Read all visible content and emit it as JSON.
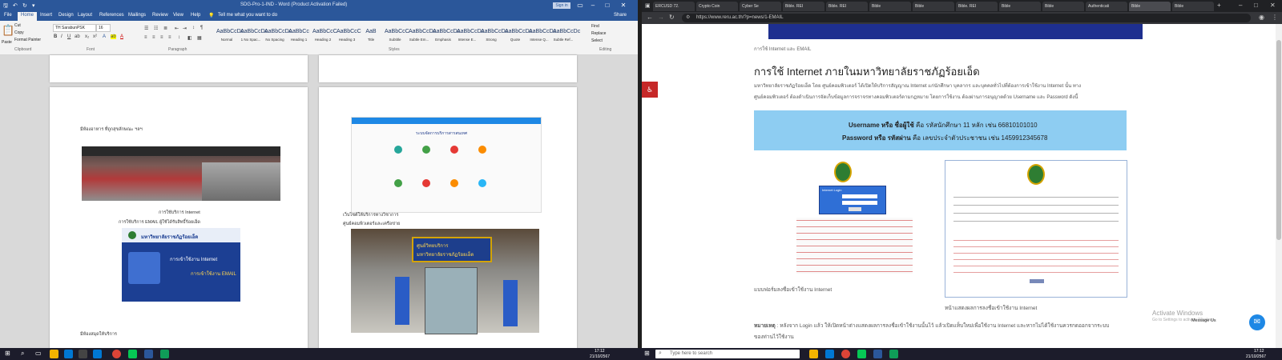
{
  "word": {
    "title_bar": {
      "doc_title": "SDG-Pro-1-IND - Word (Product Activation Failed)",
      "signin": "Sign in",
      "share": "Share"
    },
    "tabs": [
      "File",
      "Home",
      "Insert",
      "Design",
      "Layout",
      "References",
      "Mailings",
      "Review",
      "View",
      "Help"
    ],
    "tell_me": "Tell me what you want to do",
    "clipboard": {
      "paste": "Paste",
      "cut": "Cut",
      "copy": "Copy",
      "format_painter": "Format Painter",
      "label": "Clipboard"
    },
    "font": {
      "name": "TH SarabunPSK",
      "size": "16",
      "label": "Font"
    },
    "paragraph_label": "Paragraph",
    "styles": [
      "Normal",
      "1 No Spac...",
      "No Spacing",
      "Heading 1",
      "Heading 2",
      "Heading 3",
      "Title",
      "Subtitle",
      "Subtle Em...",
      "Emphasis",
      "Intense E...",
      "Strong",
      "Quote",
      "Intense Q...",
      "Subtle Ref..."
    ],
    "style_samples": [
      "AaBbCcDc",
      "AaBbCcDc",
      "AaBbCcDc",
      "AaBbCc",
      "AaBbCcC",
      "AaBbCcC",
      "AaB",
      "AaBbCcC",
      "AaBbCcDc",
      "AaBbCcDc",
      "AaBbCcDc",
      "AaBbCcDc",
      "AaBbCcDc",
      "AaBbCcDc",
      "AaBbCcDc"
    ],
    "styles_label": "Styles",
    "editing": {
      "find": "Find",
      "replace": "Replace",
      "select": "Select",
      "label": "Editing"
    },
    "page_left": {
      "line1": "มีห้องอาหาร ที่ถูกสุขลักษณะ ฯลฯ",
      "caption1": "การใช้บริการ Internet",
      "caption2": "การใช้บริการ EMAIL ผู้ใช้ได้รับสิทธิ์ร้อยเอ็ด",
      "banner_title": "มหาวิทยาลัยราชภัฏร้อยเอ็ด",
      "banner_line1": "การเข้าใช้งาน Internet",
      "banner_line2": "การเข้าใช้งาน EMAIL",
      "line_bottom": "มีห้องสมุดให้บริการ"
    },
    "page_right": {
      "screen_header": "ระบบจัดการบริการสารสนเทศ",
      "caption1": "เว็บไซต์ให้บริการทางวิชาการ",
      "caption2": "ศูนย์คอมพิวเตอร์และเครือข่าย",
      "sign_line1": "ศูนย์วิทยบริการ",
      "sign_line2": "มหาวิทยาลัยราชภัฏร้อยเอ็ด"
    }
  },
  "chrome": {
    "tabs": [
      "ERCUSD 72.",
      "Crypto Coin",
      "Cyber Se",
      "Bible. REI",
      "Bible. REI",
      "Bible",
      "Bible",
      "Bible. REI",
      "Bible",
      "Bible",
      "Authenticati",
      "Bible",
      "Bible"
    ],
    "url": "https://www.reru.ac.th/?p=news/1-EMAIL",
    "page": {
      "heading_top": "การใช้ Internet และ EMAIL",
      "heading": "การใช้ Internet ภายในมหาวิทยาลัยราชภัฏร้อยเอ็ด",
      "para_line1": "มหาวิทยาลัยราชภัฏร้อยเอ็ด โดย ศูนย์คอมพิวเตอร์ ได้เปิดให้บริการสัญญาณ Internet แก่นักศึกษา บุคลากร และบุคคลทั่วไปที่ต้องการเข้าใช้งาน Internet นั้น ทาง",
      "para_line2": "ศูนย์คอมพิวเตอร์ ต้องดำเนินการจัดเก็บข้อมูลการจราจรทางคอมพิวเตอร์ตามกฎหมาย โดยการใช้งาน ต้องผ่านการอนุญาตด้วย Username และ Password ดังนี้",
      "user_label": "Username หรือ ชื่อผู้ใช้",
      "user_text": "คือ รหัสนักศึกษา 11 หลัก เช่น 66810101010",
      "pass_label": "Password หรือ รหัสผ่าน",
      "pass_text": "คือ เลขประจำตัวประชาชน เช่น 1459912345678",
      "login_caption": "แบบฟอร์มลงชื่อเข้าใช้งาน Internet",
      "right_caption": "หน้าแสดงผลการลงชื่อเข้าใช้งาน Internet",
      "note_label": "หมายเหตุ",
      "note_text": ": หลังจาก Login แล้ว ให้เปิดหน้าต่างแสดงผลการลงชื่อเข้าใช้งานนั้นไว้ แล้วเปิดแท็บใหม่เพื่อใช้งาน Internet และหากไม่ได้ใช้งานควรกดออกจากระบบ",
      "note_line2": "ของท่านไว้ใช้งาน",
      "login_box_title": "Internet Login",
      "activate_line1": "Activate Windows",
      "activate_line2": "Go to Settings to activate Windows.",
      "message_us": "Message Us"
    }
  },
  "taskbar": {
    "search_placeholder": "Type here to search",
    "left_time": "17:12",
    "left_date": "21/10/2567",
    "right_time": "17:12",
    "right_date": "21/10/2567"
  }
}
